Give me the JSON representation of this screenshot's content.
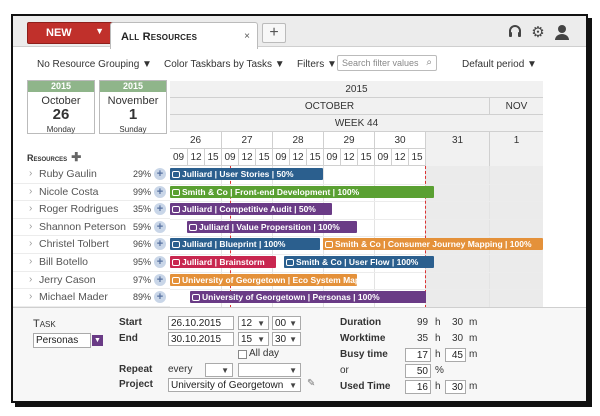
{
  "toolbar": {
    "new_label": "NEW",
    "tab_label": "All Resources",
    "tab_close": "×",
    "add_tab": "+",
    "grouping": "No Resource Grouping ▼",
    "colorbars": "Color Taskbars by Tasks ▼",
    "filters": "Filters ▼",
    "search_placeholder": "Search filter values",
    "period": "Default period ▼"
  },
  "date_cards": [
    {
      "year": "2015",
      "month": "October",
      "day": "26",
      "weekday": "Monday"
    },
    {
      "year": "2015",
      "month": "November",
      "day": "1",
      "weekday": "Sunday"
    }
  ],
  "timeline": {
    "year": "2015",
    "months": [
      "OCTOBER",
      "NOV"
    ],
    "week": "WEEK 44",
    "days": [
      "26",
      "27",
      "28",
      "29",
      "30",
      "31",
      "1"
    ],
    "hours": [
      "09",
      "12",
      "15",
      "09",
      "12",
      "15",
      "09",
      "12",
      "15",
      "09",
      "12",
      "15",
      "09",
      "12",
      "15"
    ]
  },
  "resources": {
    "header": "Resources",
    "add": "✚",
    "rows": [
      {
        "name": "Ruby Gaulin",
        "pct": "29%"
      },
      {
        "name": "Nicole Costa",
        "pct": "99%"
      },
      {
        "name": "Roger Rodrigues",
        "pct": "35%"
      },
      {
        "name": "Shannon Peterson",
        "pct": "59%"
      },
      {
        "name": "Christel Tolbert",
        "pct": "96%"
      },
      {
        "name": "Bill Botello",
        "pct": "95%"
      },
      {
        "name": "Jerry Cason",
        "pct": "97%"
      },
      {
        "name": "Michael Mader",
        "pct": "89%"
      }
    ]
  },
  "bars": [
    {
      "label": "Julliard | User Stories | 50%",
      "color": "#2b5f8e"
    },
    {
      "label": "Smith & Co | Front-end Development | 100%",
      "color": "#5aa032"
    },
    {
      "label": "Julliard | Competitive Audit | 50%",
      "color": "#6a3b86"
    },
    {
      "label": "Julliard | Value Propersition | 100%",
      "color": "#6a3b86"
    },
    {
      "label": "Julliard | Blueprint | 100%",
      "color": "#2b5f8e"
    },
    {
      "label": "Smith & Co | Consumer Journey Mapping | 100%",
      "color": "#e4913a"
    },
    {
      "label": "Julliard | Brainstorm",
      "color": "#c8264f"
    },
    {
      "label": "Smith & Co | User Flow | 100%",
      "color": "#2b5f8e"
    },
    {
      "label": "University of Georgetown | Eco System Mapping | 100%",
      "color": "#e4913a"
    },
    {
      "label": "University of Georgetown | Personas | 100%",
      "color": "#6a3b86"
    }
  ],
  "task": {
    "title": "Task",
    "name": "Personas",
    "start_label": "Start",
    "start_date": "26.10.2015",
    "start_h": "12",
    "start_m": "00",
    "end_label": "End",
    "end_date": "30.10.2015",
    "end_h": "15",
    "end_m": "30",
    "allday": "All day",
    "repeat_label": "Repeat",
    "repeat_val": "every",
    "project_label": "Project",
    "project_val": "University of Georgetown",
    "duration_label": "Duration",
    "duration_h": "99",
    "duration_m": "30",
    "worktime_label": "Worktime",
    "worktime_h": "35",
    "worktime_m": "30",
    "busy_label": "Busy time",
    "busy_h": "17",
    "busy_m": "45",
    "or_label": "or",
    "busy_pct": "50",
    "used_label": "Used Time",
    "used_h": "16",
    "used_m": "30",
    "h": "h",
    "m": "m",
    "pct": "%",
    "edit": "✎"
  }
}
